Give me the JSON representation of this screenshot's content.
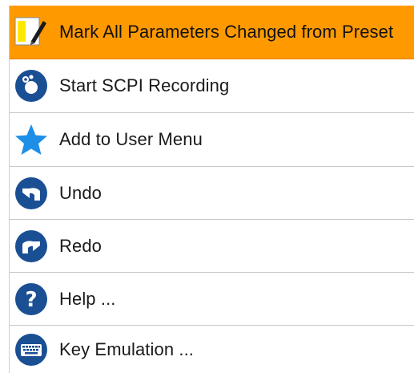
{
  "menu": {
    "items": [
      {
        "label": "Mark All Parameters Changed from Preset",
        "icon": "edit-pencil-icon",
        "active": true
      },
      {
        "label": "Start SCPI Recording",
        "icon": "scpi-record-icon",
        "active": false
      },
      {
        "label": "Add to User Menu",
        "icon": "star-icon",
        "active": false
      },
      {
        "label": "Undo",
        "icon": "undo-icon",
        "active": false
      },
      {
        "label": "Redo",
        "icon": "redo-icon",
        "active": false
      },
      {
        "label": "Help ...",
        "icon": "help-icon",
        "active": false
      },
      {
        "label": "Key Emulation ...",
        "icon": "keyboard-icon",
        "active": false
      }
    ]
  },
  "colors": {
    "highlight": "#ff9900",
    "icon_blue": "#1a4f94",
    "star_blue": "#1e8fe8",
    "separator": "#c8c8c8"
  }
}
